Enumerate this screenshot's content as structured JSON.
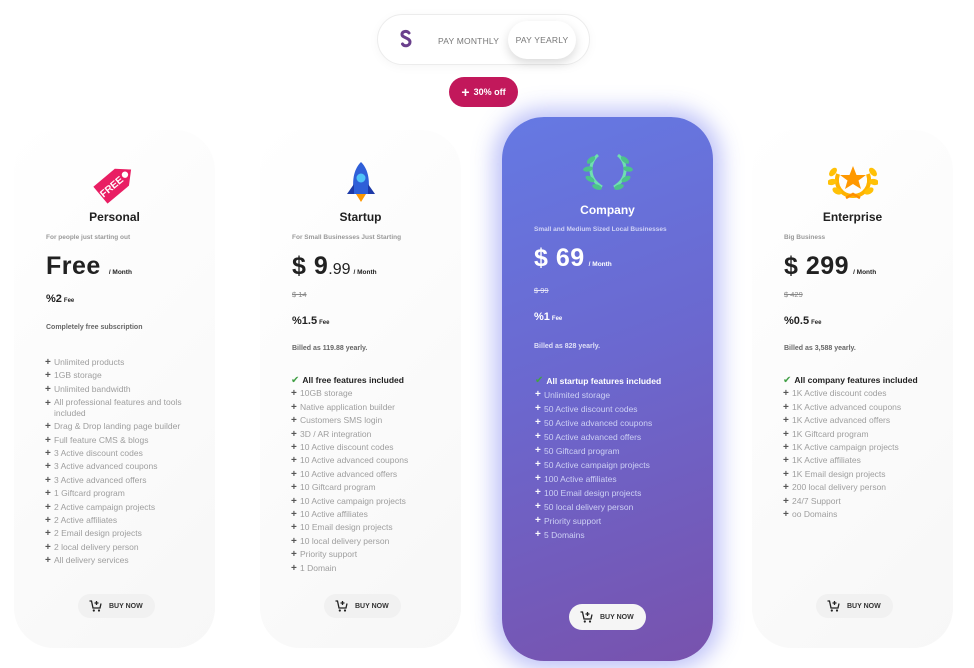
{
  "billing_toggle": {
    "logo_icon": "s-logo-icon",
    "monthly_label": "PAY MONTHLY",
    "yearly_label": "PAY YEARLY",
    "selected": "yearly"
  },
  "discount_badge": {
    "icon": "plus-icon",
    "label": "30% off"
  },
  "accent_colors": {
    "badge": "#c2185b",
    "featured_gradient_start": "#6579e3",
    "featured_gradient_end": "#7852ad",
    "check": "#43a047"
  },
  "plans": [
    {
      "icon": "free-tag-icon",
      "name": "Personal",
      "subtitle": "For people just starting out",
      "price_main": "Free",
      "price_cents": "",
      "per": "/ Month",
      "old_price": "",
      "fee_value": "%2",
      "fee_label": "Fee",
      "note": "Completely free subscription",
      "headline": "",
      "features": [
        "Unlimited products",
        "1GB storage",
        "Unlimited bandwidth",
        "All professional features and tools included",
        "Drag & Drop landing page builder",
        "Full feature CMS & blogs",
        "3 Active discount codes",
        "3 Active advanced coupons",
        "3 Active advanced offers",
        "1 Giftcard program",
        "2 Active campaign projects",
        "2 Active affiliates",
        "2 Email design projects",
        "2 local delivery person",
        "All delivery services"
      ],
      "buy_label": "BUY NOW"
    },
    {
      "icon": "rocket-icon",
      "name": "Startup",
      "subtitle": "For Small Businesses Just Starting",
      "price_main": "$ 9",
      "price_cents": ".99",
      "per": "/ Month",
      "old_price": "$ 14",
      "fee_value": "%1.5",
      "fee_label": "Fee",
      "note": "Billed as 119.88 yearly.",
      "headline": "All free features included",
      "features": [
        "10GB storage",
        "Native application builder",
        "Customers SMS login",
        "3D / AR integration",
        "10 Active discount codes",
        "10 Active advanced coupons",
        "10 Active advanced offers",
        "10 Giftcard program",
        "10 Active campaign projects",
        "10 Active affiliates",
        "10 Email design projects",
        "10 local delivery person",
        "Priority support",
        "1 Domain"
      ],
      "buy_label": "BUY NOW"
    },
    {
      "icon": "laurel-wreath-icon",
      "name": "Company",
      "subtitle": "Small and Medium Sized Local Businesses",
      "price_main": "$ 69",
      "price_cents": "",
      "per": "/ Month",
      "old_price": "$ 99",
      "fee_value": "%1",
      "fee_label": "Fee",
      "note": "Billed as 828 yearly.",
      "headline": "All startup features included",
      "features": [
        "Unlimited storage",
        "50 Active discount codes",
        "50 Active advanced coupons",
        "50 Active advanced offers",
        "50 Giftcard program",
        "50 Active campaign projects",
        "100 Active affiliates",
        "100 Email design projects",
        "50 local delivery person",
        "Priority support",
        "5 Domains"
      ],
      "buy_label": "BUY NOW"
    },
    {
      "icon": "star-laurel-icon",
      "name": "Enterprise",
      "subtitle": "Big Business",
      "price_main": "$ 299",
      "price_cents": "",
      "per": "/ Month",
      "old_price": "$ 429",
      "fee_value": "%0.5",
      "fee_label": "Fee",
      "note": "Billed as 3,588 yearly.",
      "headline": "All company features included",
      "features": [
        "1K Active discount codes",
        "1K Active advanced coupons",
        "1K Active advanced offers",
        "1K Giftcard program",
        "1K Active campaign projects",
        "1K Active affiliates",
        "1K Email design projects",
        "200 local delivery person",
        "24/7 Support",
        "oo Domains"
      ],
      "buy_label": "BUY NOW"
    }
  ]
}
